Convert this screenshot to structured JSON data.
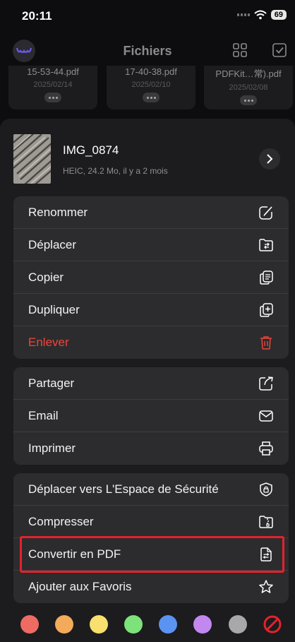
{
  "status": {
    "time": "20:11",
    "battery": "69"
  },
  "header": {
    "title": "Fichiers"
  },
  "thumbnails": [
    {
      "name": "15-53-44.pdf",
      "date": "2025/02/14"
    },
    {
      "name": "17-40-38.pdf",
      "date": "2025/02/10"
    },
    {
      "name": "PDFKit…常).pdf",
      "date": "2025/02/08"
    }
  ],
  "file": {
    "name": "IMG_0874",
    "meta": "HEIC, 24.2 Mo, il y a 2 mois"
  },
  "menu": {
    "group1": [
      "Renommer",
      "Déplacer",
      "Copier",
      "Dupliquer",
      "Enlever"
    ],
    "group2": [
      "Partager",
      "Email",
      "Imprimer"
    ],
    "group3": [
      "Déplacer vers L'Espace de Sécurité",
      "Compresser",
      "Convertir en PDF",
      "Ajouter aux Favoris"
    ]
  },
  "tag_colors": [
    "#ee6b63",
    "#f3aa5a",
    "#f7e06e",
    "#7ee27a",
    "#5b93f2",
    "#c288f0",
    "#a8a8ac"
  ],
  "accent_danger": "#f0443a",
  "highlight_color": "#e4222c"
}
